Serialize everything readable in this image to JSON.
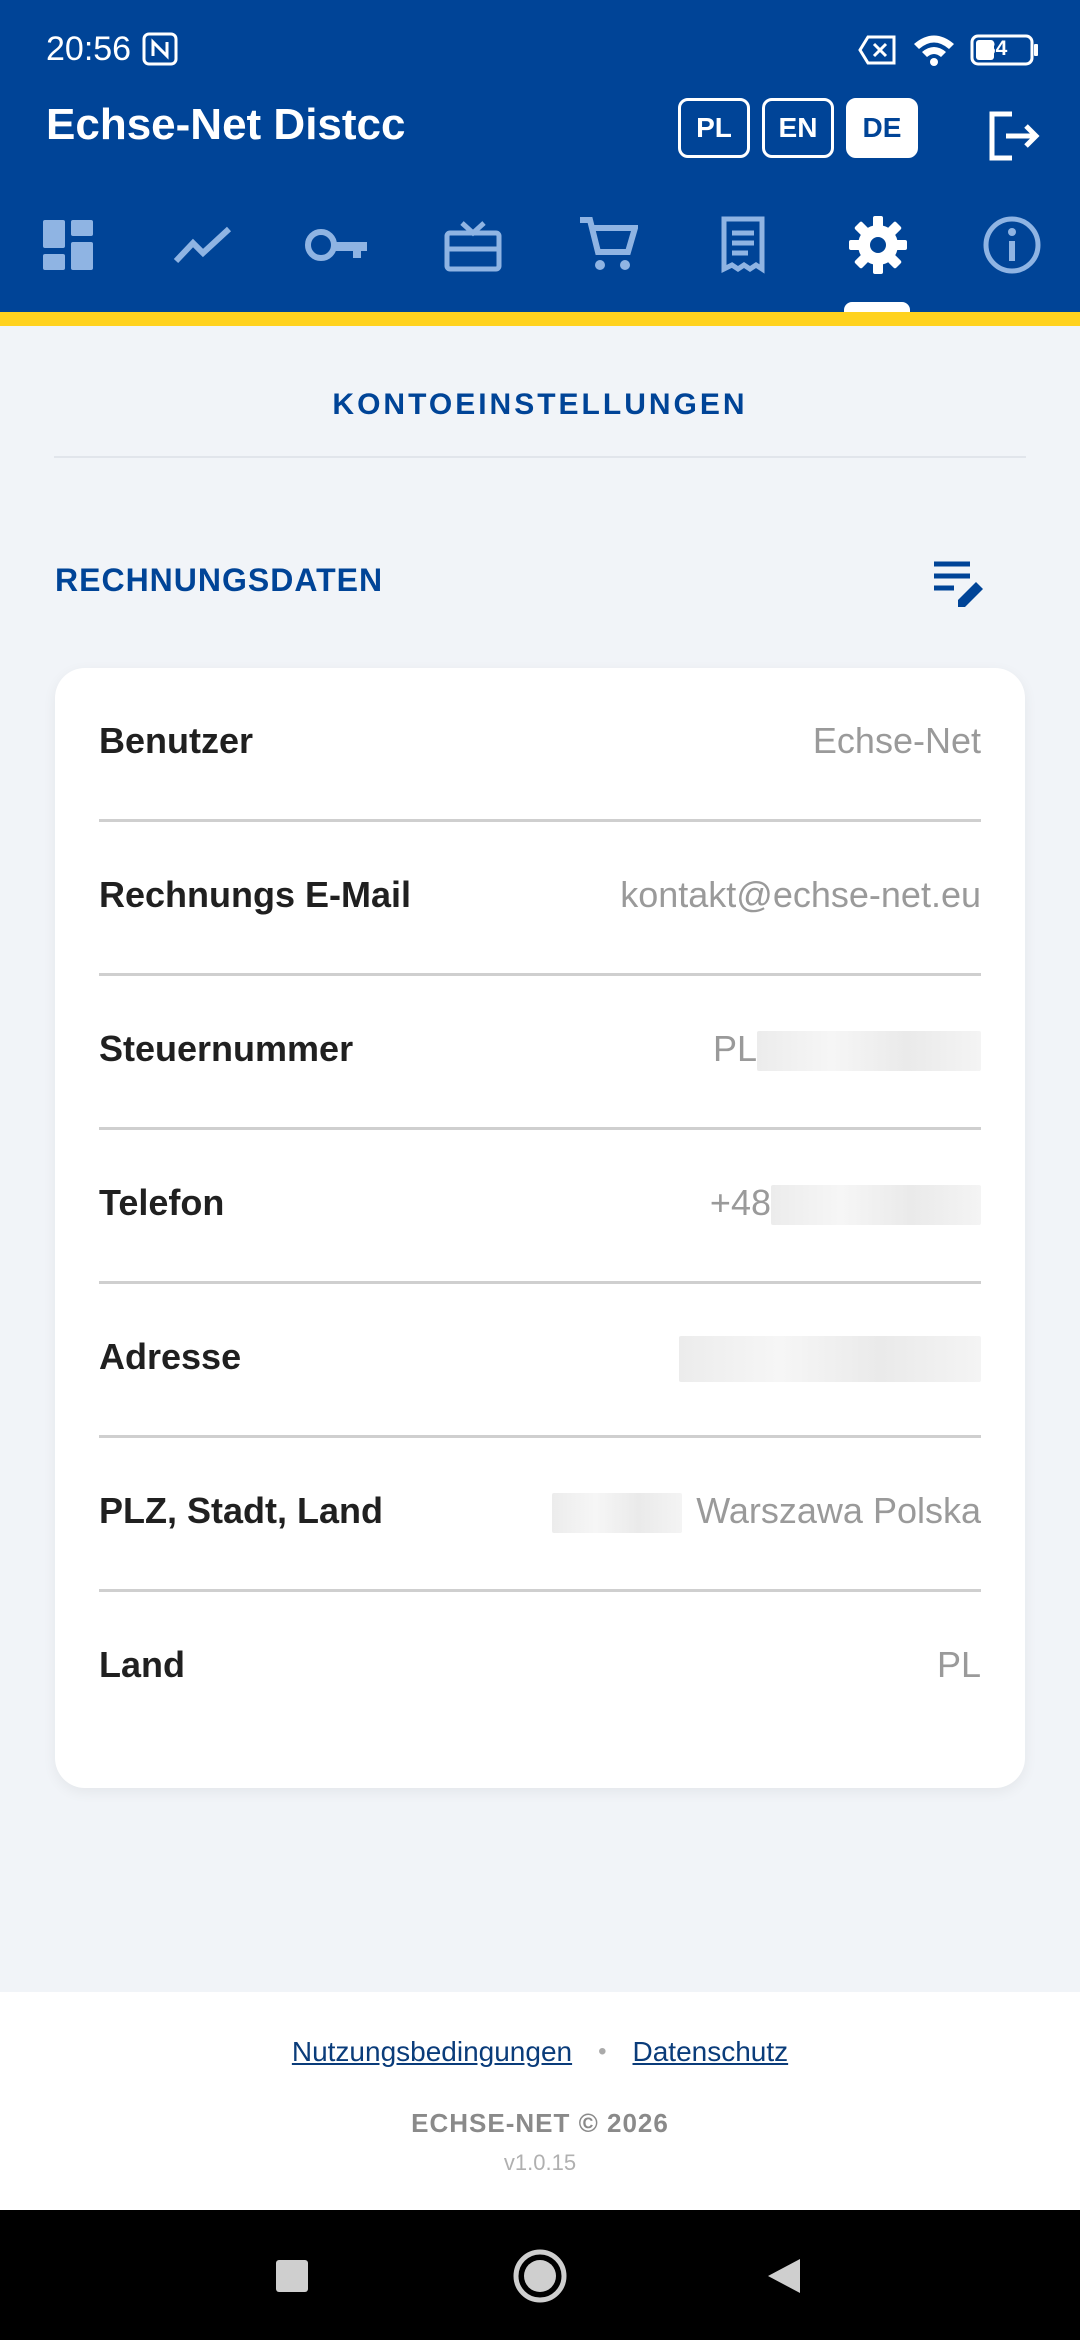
{
  "status_bar": {
    "time": "20:56",
    "battery": "34"
  },
  "header": {
    "app_title": "Echse-Net Distcc",
    "languages": [
      {
        "label": "PL",
        "active": false
      },
      {
        "label": "EN",
        "active": false
      },
      {
        "label": "DE",
        "active": true
      }
    ]
  },
  "nav": {
    "icons": [
      "dashboard-icon",
      "trending-icon",
      "key-icon",
      "voucher-icon",
      "cart-icon",
      "receipt-icon",
      "settings-icon",
      "info-icon"
    ],
    "active_index": 6
  },
  "page": {
    "title": "KONTOEINSTELLUNGEN",
    "section_title": "RECHNUNGSDATEN"
  },
  "billing": {
    "rows": [
      {
        "label": "Benutzer",
        "value": "Echse-Net"
      },
      {
        "label": "Rechnungs E-Mail",
        "value": "kontakt@echse-net.eu"
      },
      {
        "label": "Steuernummer",
        "value": "PL"
      },
      {
        "label": "Telefon",
        "value": "+48"
      },
      {
        "label": "Adresse",
        "value": ""
      },
      {
        "label": "PLZ, Stadt, Land",
        "value": "Warszawa Polska"
      },
      {
        "label": "Land",
        "value": "PL"
      }
    ]
  },
  "footer": {
    "terms": "Nutzungsbedingungen",
    "separator": "•",
    "privacy": "Datenschutz",
    "copyright": "ECHSE-NET © 2026",
    "version": "v1.0.15"
  },
  "colors": {
    "primary": "#004497",
    "accent": "#ffd21f",
    "background": "#f1f4f8"
  }
}
